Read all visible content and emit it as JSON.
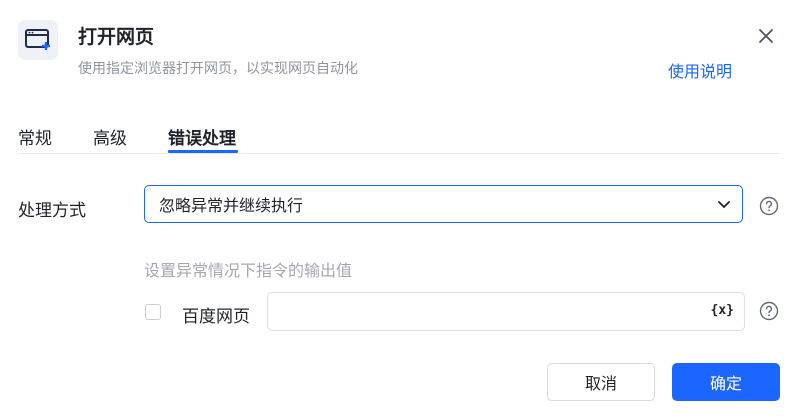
{
  "header": {
    "icon": "browser-open-icon",
    "title": "打开网页",
    "subtitle": "使用指定浏览器打开网页，以实现网页自动化",
    "help_link": "使用说明",
    "close_icon": "close-icon"
  },
  "tabs": [
    {
      "label": "常规",
      "active": false
    },
    {
      "label": "高级",
      "active": false
    },
    {
      "label": "错误处理",
      "active": true
    }
  ],
  "form": {
    "handling_label": "处理方式",
    "handling_value": "忽略异常并继续执行",
    "output_hint": "设置异常情况下指令的输出值",
    "checkbox_label": "百度网页",
    "checkbox_checked": false,
    "output_value": "",
    "variable_button": "{x}"
  },
  "footer": {
    "cancel": "取消",
    "ok": "确定"
  },
  "colors": {
    "accent": "#1a66ff",
    "text": "#1f2329",
    "muted": "#8f959e"
  }
}
